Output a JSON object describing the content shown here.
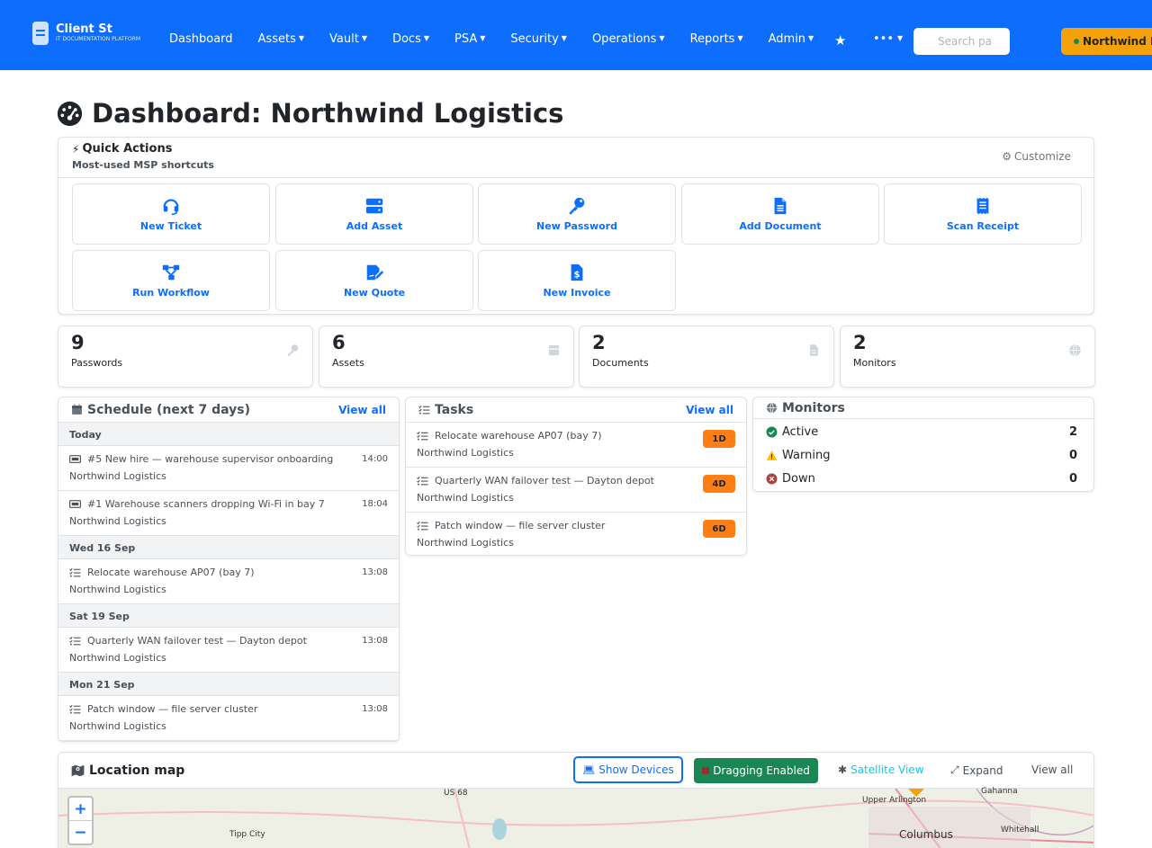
{
  "brand": {
    "name": "Client St",
    "tagline": "IT DOCUMENTATION PLATFORM"
  },
  "nav": {
    "items": [
      {
        "label": "Dashboard",
        "dropdown": false
      },
      {
        "label": "Assets",
        "dropdown": true
      },
      {
        "label": "Vault",
        "dropdown": true
      },
      {
        "label": "Docs",
        "dropdown": true
      },
      {
        "label": "PSA",
        "dropdown": true
      },
      {
        "label": "Security",
        "dropdown": true
      },
      {
        "label": "Operations",
        "dropdown": true
      },
      {
        "label": "Reports",
        "dropdown": true
      },
      {
        "label": "Admin",
        "dropdown": true
      }
    ],
    "more_label": "•••",
    "search_placeholder": "Search pa",
    "org_label": "Northwind L"
  },
  "page": {
    "title": "Dashboard: Northwind Logistics"
  },
  "quick_actions": {
    "title": "Quick Actions",
    "subtitle": "Most-used MSP shortcuts",
    "customize_label": "Customize",
    "buttons": [
      {
        "label": "New Ticket",
        "icon": "headset-icon"
      },
      {
        "label": "Add Asset",
        "icon": "server-icon"
      },
      {
        "label": "New Password",
        "icon": "key-icon"
      },
      {
        "label": "Add Document",
        "icon": "document-icon"
      },
      {
        "label": "Scan Receipt",
        "icon": "receipt-icon"
      },
      {
        "label": "Run Workflow",
        "icon": "workflow-icon"
      },
      {
        "label": "New Quote",
        "icon": "quote-icon"
      },
      {
        "label": "New Invoice",
        "icon": "invoice-icon"
      }
    ]
  },
  "stats": [
    {
      "value": "9",
      "label": "Passwords",
      "icon": "key-icon"
    },
    {
      "value": "6",
      "label": "Assets",
      "icon": "box-icon"
    },
    {
      "value": "2",
      "label": "Documents",
      "icon": "file-icon"
    },
    {
      "value": "2",
      "label": "Monitors",
      "icon": "globe-icon"
    }
  ],
  "schedule": {
    "title": "Schedule (next 7 days)",
    "view_all": "View all",
    "days": [
      {
        "label": "Today",
        "events": [
          {
            "title": "#5 New hire — warehouse supervisor onboarding",
            "org": "Northwind Logistics",
            "time": "14:00",
            "kind": "ticket"
          },
          {
            "title": "#1 Warehouse scanners dropping Wi-Fi in bay 7",
            "org": "Northwind Logistics",
            "time": "18:04",
            "kind": "ticket"
          }
        ]
      },
      {
        "label": "Wed 16 Sep",
        "events": [
          {
            "title": "Relocate warehouse AP07 (bay 7)",
            "org": "Northwind Logistics",
            "time": "13:08",
            "kind": "task"
          }
        ]
      },
      {
        "label": "Sat 19 Sep",
        "events": [
          {
            "title": "Quarterly WAN failover test — Dayton depot",
            "org": "Northwind Logistics",
            "time": "13:08",
            "kind": "task"
          }
        ]
      },
      {
        "label": "Mon 21 Sep",
        "events": [
          {
            "title": "Patch window — file server cluster",
            "org": "Northwind Logistics",
            "time": "13:08",
            "kind": "task"
          }
        ]
      }
    ]
  },
  "tasks": {
    "title": "Tasks",
    "view_all": "View all",
    "items": [
      {
        "title": "Relocate warehouse AP07 (bay 7)",
        "org": "Northwind Logistics",
        "due": "1D"
      },
      {
        "title": "Quarterly WAN failover test — Dayton depot",
        "org": "Northwind Logistics",
        "due": "4D"
      },
      {
        "title": "Patch window — file server cluster",
        "org": "Northwind Logistics",
        "due": "6D"
      }
    ]
  },
  "monitors": {
    "title": "Monitors",
    "rows": [
      {
        "label": "Active",
        "count": "2",
        "color": "#198754"
      },
      {
        "label": "Warning",
        "count": "0",
        "color": "#ffc107"
      },
      {
        "label": "Down",
        "count": "0",
        "color": "#a94442"
      }
    ]
  },
  "map": {
    "title": "Location map",
    "show_devices": "Show Devices",
    "dragging": "Dragging Enabled",
    "satellite": "Satellite View",
    "expand": "Expand",
    "view_all": "View all",
    "labels": [
      "US 68",
      "Tipp City",
      "Upper Arlington",
      "Gahanna",
      "Whitehall",
      "Columbus"
    ]
  },
  "colors": {
    "primary": "#0d6efd",
    "warning": "#fd7e14",
    "success": "#198754",
    "org_badge": "#f5a20a"
  }
}
